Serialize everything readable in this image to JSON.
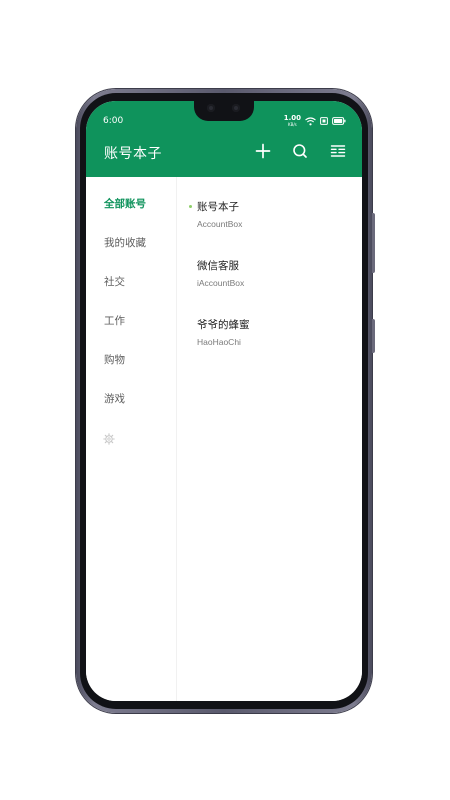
{
  "status_bar": {
    "time": "6:00",
    "net_speed": "1.00",
    "net_unit": "KB/s"
  },
  "header": {
    "title": "账号本子",
    "background": "#0f935c",
    "actions": [
      "add-icon",
      "search-icon",
      "menu-icon"
    ]
  },
  "sidebar": {
    "accent": "#0f935c",
    "items": [
      {
        "label": "全部账号",
        "active": true
      },
      {
        "label": "我的收藏",
        "active": false
      },
      {
        "label": "社交",
        "active": false
      },
      {
        "label": "工作",
        "active": false
      },
      {
        "label": "购物",
        "active": false
      },
      {
        "label": "游戏",
        "active": false
      }
    ],
    "settings_icon": "gear-icon"
  },
  "accounts": [
    {
      "name": "账号本子",
      "account": "AccountBox"
    },
    {
      "name": "微信客服",
      "account": "iAccountBox"
    },
    {
      "name": "爷爷的蜂蜜",
      "account": "HaoHaoChi"
    }
  ]
}
